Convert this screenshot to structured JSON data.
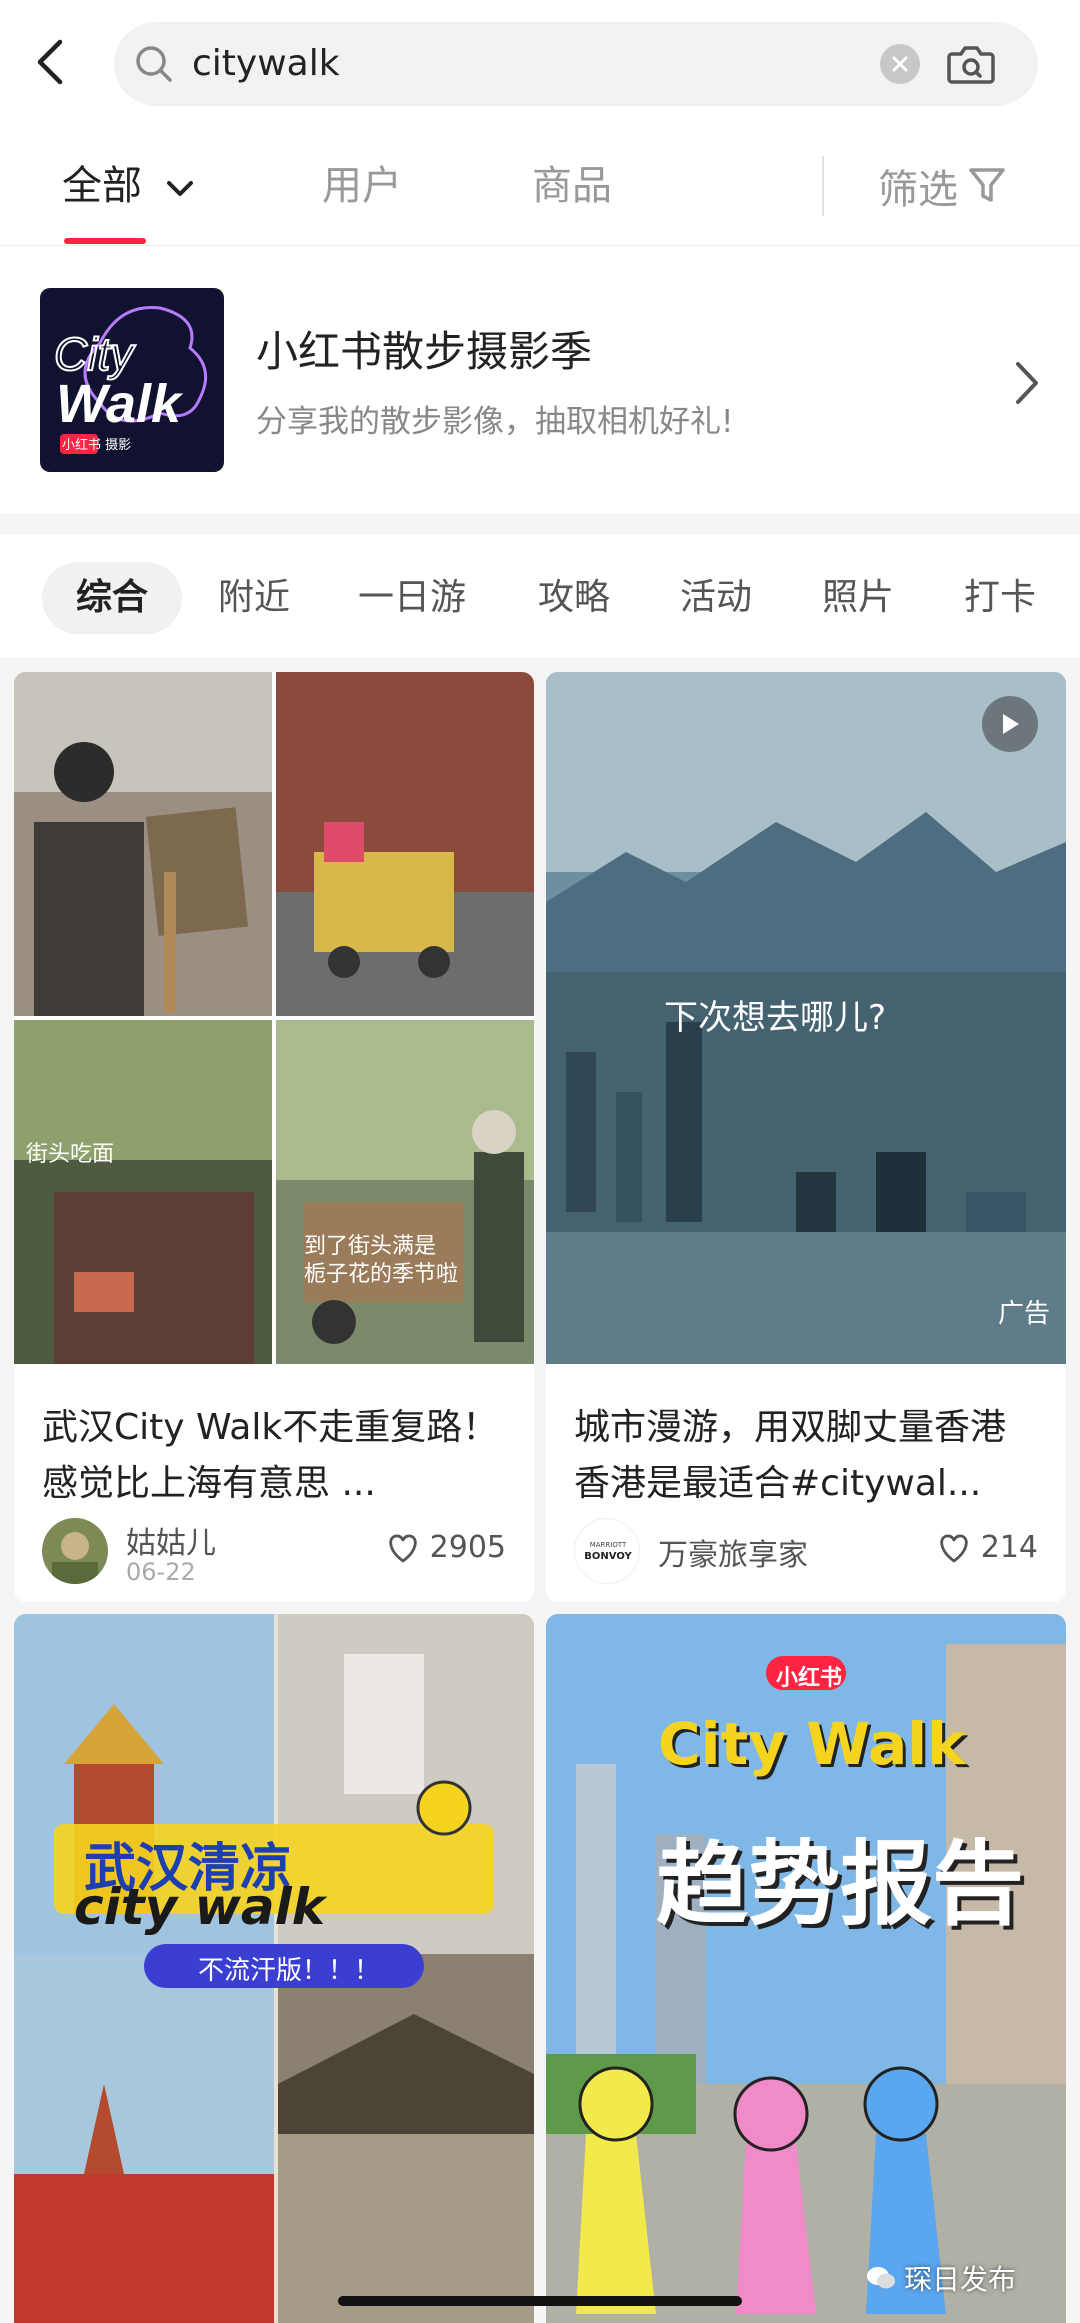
{
  "search": {
    "query": "citywalk"
  },
  "categories": {
    "tabs": [
      "全部",
      "用户",
      "商品"
    ],
    "filter_label": "筛选"
  },
  "banner": {
    "logo_word_1": "City",
    "logo_word_2": "Walk",
    "logo_sub": "小红书 摄影",
    "title": "小红书散步摄影季",
    "subtitle": "分享我的散步影像，抽取相机好礼!"
  },
  "sub_tabs": [
    "综合",
    "附近",
    "一日游",
    "攻略",
    "活动",
    "照片",
    "打卡"
  ],
  "feed": {
    "cards": [
      {
        "title": "武汉City Walk不走重复路！感觉比上海有意思 ...",
        "author": "姑姑儿",
        "date": "06-22",
        "likes": "2905",
        "overlay_1": "街头吃面",
        "overlay_2": "到了街头满是",
        "overlay_3": "栀子花的季节啦"
      },
      {
        "title": "城市漫游，用双脚丈量香港 香港是最适合#citywal...",
        "author": "万豪旅享家",
        "author_logo_1": "MARRIOTT",
        "author_logo_2": "BONVOY",
        "likes": "214",
        "overlay_center": "下次想去哪儿?",
        "ad_label": "广告"
      },
      {
        "overlay_title_1": "武汉清凉",
        "overlay_title_2": "city walk",
        "overlay_badge": "不流汗版！！！"
      },
      {
        "brand_badge": "小红书",
        "overlay_title": "City Walk",
        "overlay_sub": "趋势报告"
      }
    ]
  },
  "watermark": "琛日发布",
  "colors": {
    "accent": "#ff2442",
    "muted": "#999999",
    "feed_bg": "#f5f5f5"
  }
}
